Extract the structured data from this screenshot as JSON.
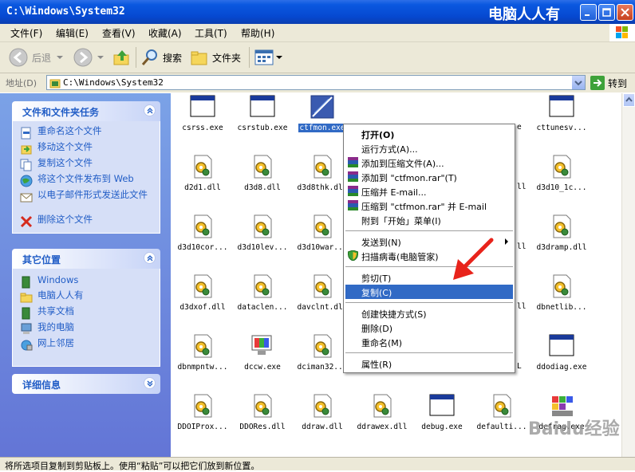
{
  "window": {
    "title": "C:\\Windows\\System32",
    "logo_text": "电脑人人有"
  },
  "menu": [
    "文件(F)",
    "编辑(E)",
    "查看(V)",
    "收藏(A)",
    "工具(T)",
    "帮助(H)"
  ],
  "toolbar": {
    "back": "后退",
    "search": "搜索",
    "folders": "文件夹"
  },
  "address": {
    "label": "地址(D)",
    "value": "C:\\Windows\\System32",
    "go": "转到"
  },
  "panels": {
    "tasks": {
      "title": "文件和文件夹任务",
      "items": [
        "重命名这个文件",
        "移动这个文件",
        "复制这个文件",
        "将这个文件发布到 Web",
        "以电子邮件形式发送此文件",
        "删除这个文件"
      ]
    },
    "places": {
      "title": "其它位置",
      "items": [
        "Windows",
        "电脑人人有",
        "共享文档",
        "我的电脑",
        "网上邻居"
      ]
    },
    "details": {
      "title": "详细信息"
    }
  },
  "files": [
    "csrss.exe",
    "csrstub.exe",
    "ctfmon.exe",
    "",
    "",
    "",
    "cttunesv...",
    "d2d1.dll",
    "d3d8.dll",
    "d3d8thk.dll",
    "",
    "",
    "",
    "d3d10_1c...",
    "d3d10cor...",
    "d3d10lev...",
    "d3d10war...",
    "",
    "",
    "",
    "d3dramp.dll",
    "d3dxof.dll",
    "dataclen...",
    "davclnt.dll",
    "",
    "",
    "",
    "dbnetlib...",
    "dbnmpntw...",
    "dccw.exe",
    "dciman32...",
    "",
    "",
    "",
    "ddodiag.exe",
    "DDOIProx...",
    "DDORes.dll",
    "ddraw.dll",
    "ddrawex.dll",
    "debug.exe",
    "defaulti...",
    "defrag.exe"
  ],
  "context_menu": {
    "open": "打开(O)",
    "run_as": "运行方式(A)...",
    "add_archive": "添加到压缩文件(A)...",
    "add_rar": "添加到 \"ctfmon.rar\"(T)",
    "compress_email": "压缩并 E-mail...",
    "compress_rar_email": "压缩到 \"ctfmon.rar\" 并 E-mail",
    "pin_start": "附到「开始」菜单(I)",
    "send_to": "发送到(N)",
    "scan_virus": "扫描病毒(电脑管家)",
    "cut": "剪切(T)",
    "copy": "复制(C)",
    "shortcut": "创建快捷方式(S)",
    "delete": "删除(D)",
    "rename": "重命名(M)",
    "properties": "属性(R)"
  },
  "partial_labels": {
    "r1": "e",
    "r2": "ll",
    "r3": "ll",
    "r4": "ll",
    "r5": "L"
  },
  "status": "将所选项目复制到剪贴板上。使用“粘贴”可以把它们放到新位置。",
  "watermark": "Baidu经验",
  "colors": {
    "titlebar": "#0a58e0",
    "highlight": "#316ac5",
    "panel_bg": "#d6dff7",
    "link": "#215dc6",
    "arrow": "#e8231b"
  }
}
